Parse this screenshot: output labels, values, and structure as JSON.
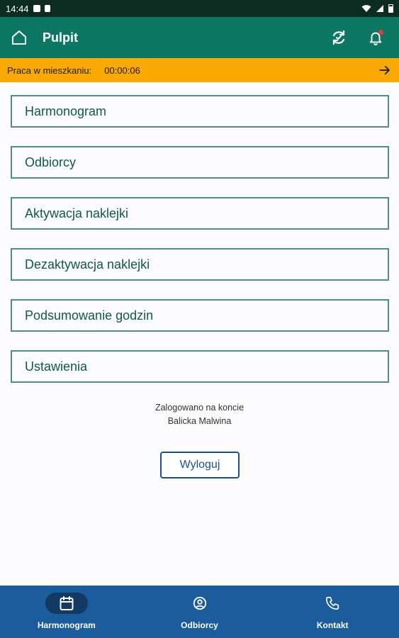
{
  "status_bar": {
    "time": "14:44"
  },
  "app_bar": {
    "title": "Pulpit"
  },
  "timer": {
    "label": "Praca w mieszkaniu:",
    "value": "00:00:06"
  },
  "menu": {
    "items": [
      {
        "label": "Harmonogram"
      },
      {
        "label": "Odbiorcy"
      },
      {
        "label": "Aktywacja naklejki"
      },
      {
        "label": "Dezaktywacja naklejki"
      },
      {
        "label": "Podsumowanie godzin"
      },
      {
        "label": "Ustawienia"
      }
    ]
  },
  "login": {
    "line1": "Zalogowano na koncie",
    "user": "Balicka Malwina",
    "logout_label": "Wyloguj"
  },
  "bottom_nav": {
    "tabs": [
      {
        "label": "Harmonogram",
        "icon": "calendar-icon",
        "active": true
      },
      {
        "label": "Odbiorcy",
        "icon": "account-circle-icon",
        "active": false
      },
      {
        "label": "Kontakt",
        "icon": "phone-icon",
        "active": false
      }
    ]
  },
  "colors": {
    "primary": "#0c7864",
    "accent": "#f9a902",
    "nav": "#1b5c9c",
    "menu_border": "#4f8e80",
    "logout": "#1a4e96"
  }
}
